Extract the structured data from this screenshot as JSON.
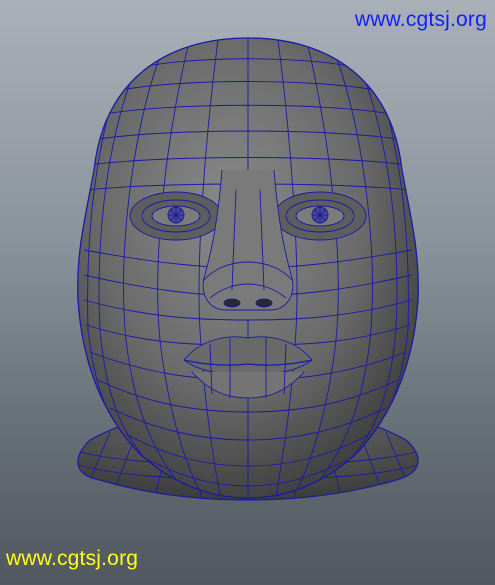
{
  "viewport": {
    "subject": "head-mesh",
    "wire_color": "#1a1aa8",
    "shade_color": "#707070"
  },
  "watermarks": {
    "top": "www.cgtsj.org",
    "bottom": "www.cgtsj.org",
    "top_color": "#1520ff",
    "bottom_color": "#ffff1a"
  }
}
